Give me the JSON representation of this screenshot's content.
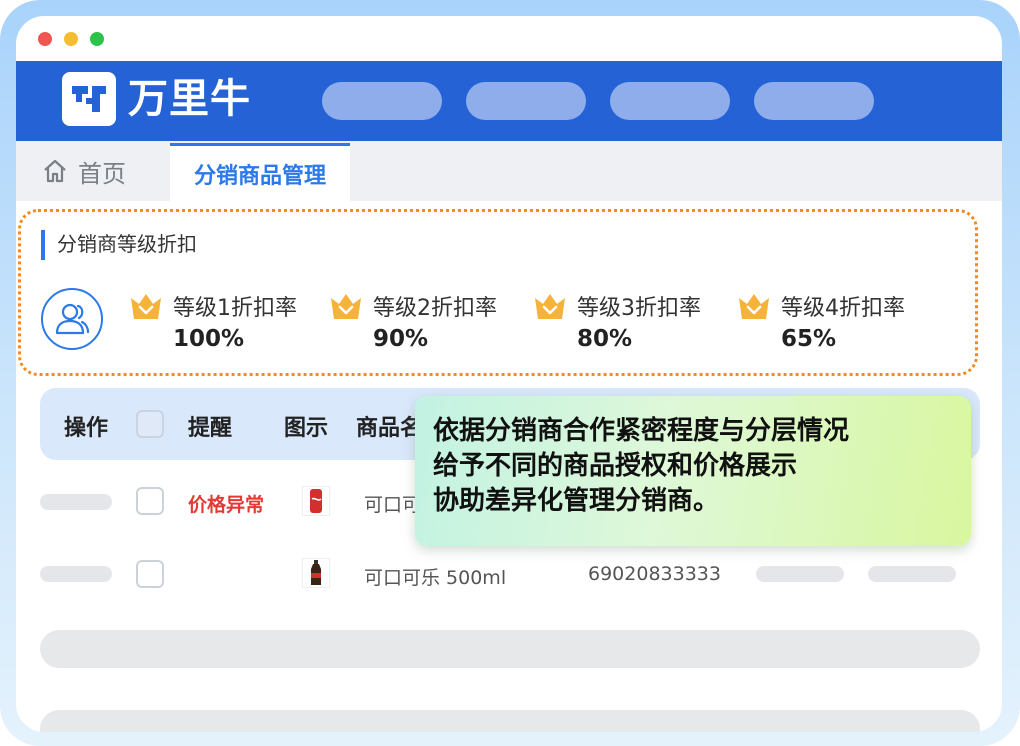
{
  "brand": {
    "name": "万里牛"
  },
  "tabs": {
    "home": "首页",
    "active": "分销商品管理"
  },
  "discount_section": {
    "title": "分销商等级折扣",
    "levels": [
      {
        "label": "等级1折扣率",
        "value": "100%"
      },
      {
        "label": "等级2折扣率",
        "value": "90%"
      },
      {
        "label": "等级3折扣率",
        "value": "80%"
      },
      {
        "label": "等级4折扣率",
        "value": "65%"
      }
    ]
  },
  "table": {
    "headers": {
      "action": "操作",
      "reminder": "提醒",
      "image": "图示",
      "product_name": "商品名"
    },
    "rows": [
      {
        "reminder": "价格异常",
        "product_name": "可口可",
        "code": ""
      },
      {
        "reminder": "",
        "product_name": "可口可乐 500ml",
        "code": "69020833333"
      }
    ]
  },
  "callout": {
    "lines": [
      "依据分销商合作紧密程度与分层情况",
      "给予不同的商品授权和价格展示",
      "协助差异化管理分销商。"
    ]
  },
  "colors": {
    "header_blue": "#2462d6",
    "accent_blue": "#2b79ea",
    "dotted_orange": "#f08a24",
    "crown_gold": "#f5b33b",
    "warning_red": "#e53935"
  },
  "icons": [
    "home-icon",
    "users-icon",
    "crown-icon",
    "cola-can-icon",
    "cola-bottle-icon"
  ]
}
